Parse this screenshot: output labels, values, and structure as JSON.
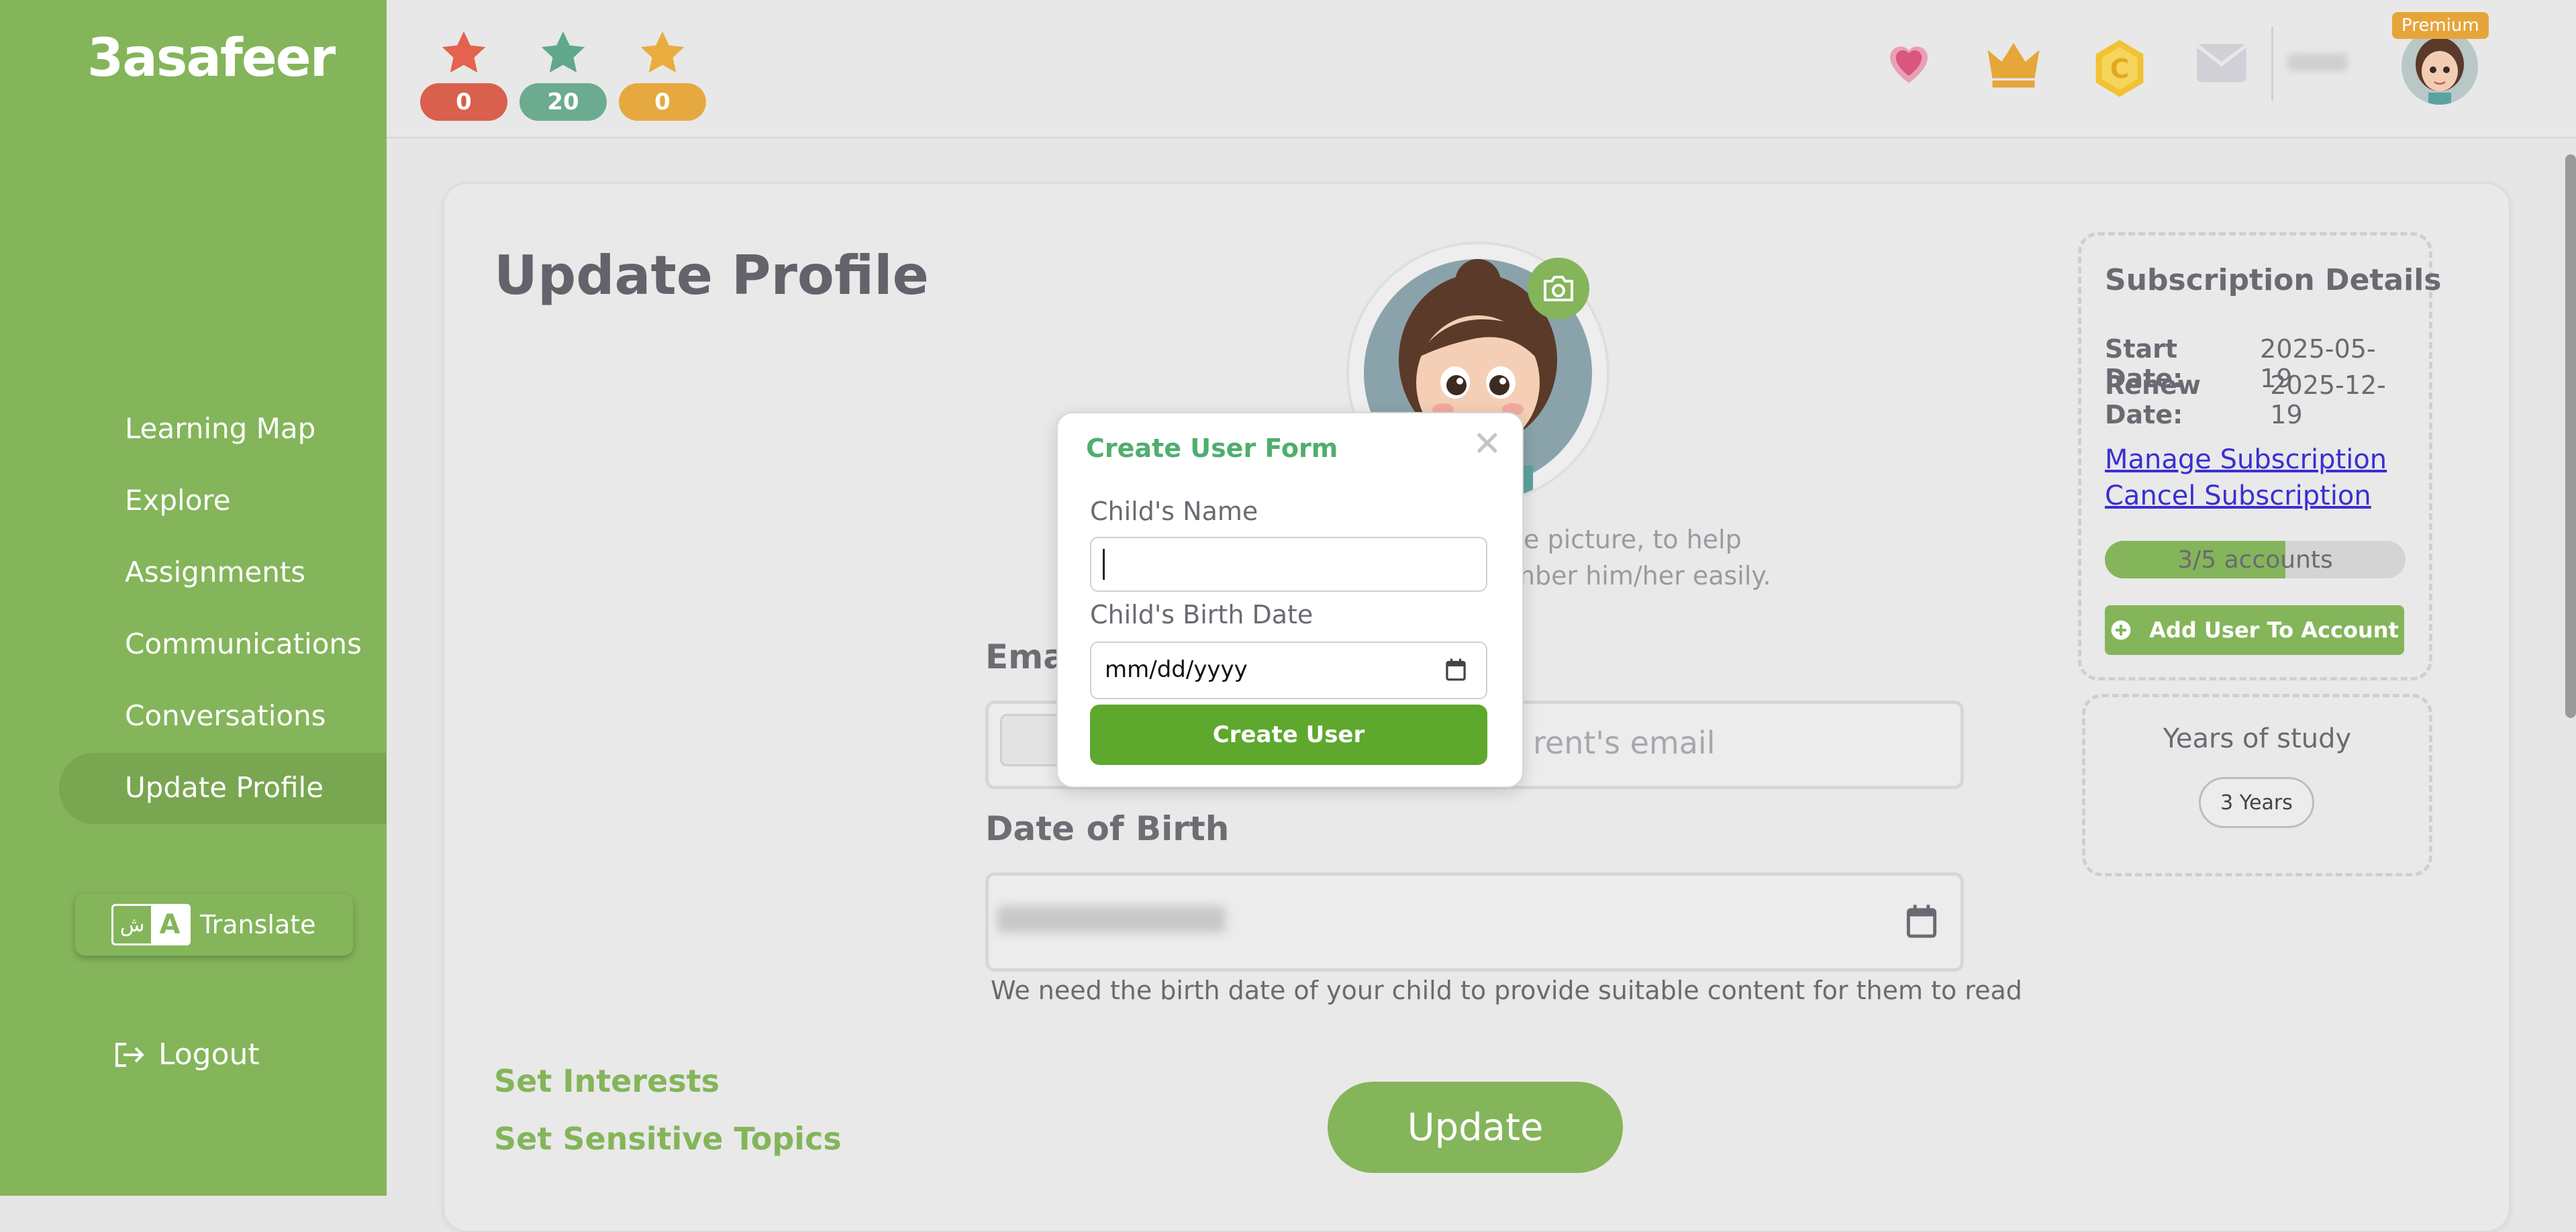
{
  "sidebar": {
    "logo": "3asafeer",
    "items": [
      {
        "label": "Learning Map"
      },
      {
        "label": "Explore"
      },
      {
        "label": "Assignments"
      },
      {
        "label": "Communications"
      },
      {
        "label": "Conversations"
      },
      {
        "label": "Update Profile",
        "active": true
      }
    ],
    "translate": {
      "label": "Translate",
      "icon_left": "ش",
      "icon_right": "A"
    },
    "logout": "Logout"
  },
  "topbar": {
    "stars": [
      {
        "count": "0",
        "color": "#e5624e",
        "badge": "#d9604c"
      },
      {
        "count": "20",
        "color": "#5fa98a",
        "badge": "#6cab90"
      },
      {
        "count": "0",
        "color": "#e9ac3e",
        "badge": "#e6a93f"
      }
    ],
    "icons": [
      "heart-icon",
      "crown-icon",
      "coin-icon",
      "mail-icon"
    ],
    "premium_badge": "Premium"
  },
  "main": {
    "title": "Update Profile",
    "photo_hint_line1": "e picture, to help",
    "photo_hint_line2": "mber him/her easily.",
    "email_label": "Ema",
    "email_placeholder": "rent's email",
    "dob_label": "Date of Birth",
    "dob_note": "We need the birth date of your child to provide suitable content for them to read",
    "links": [
      "Set Interests",
      "Set Sensitive Topics"
    ],
    "update_button": "Update"
  },
  "subscription": {
    "title": "Subscription Details",
    "start_label": "Start Date:",
    "start_value": "2025-05-19",
    "renew_label": "Renew Date:",
    "renew_value": "2025-12-19",
    "manage_link": "Manage Subscription",
    "cancel_link": "Cancel Subscription",
    "accounts_text": "3/5 accounts",
    "accounts_used": 3,
    "accounts_total": 5,
    "add_user_button": "Add User To Account"
  },
  "years": {
    "title": "Years of study",
    "value": "3 Years"
  },
  "modal": {
    "title": "Create User Form",
    "close": "✕",
    "name_label": "Child's Name",
    "name_value": "",
    "birth_label": "Child's Birth Date",
    "birth_placeholder": "mm/dd/yyyy",
    "submit": "Create User"
  },
  "colors": {
    "brand_green": "#84b55a",
    "button_green": "#5ea82e",
    "link_blue": "#3a2fd2",
    "premium_orange": "#e6a53a"
  }
}
